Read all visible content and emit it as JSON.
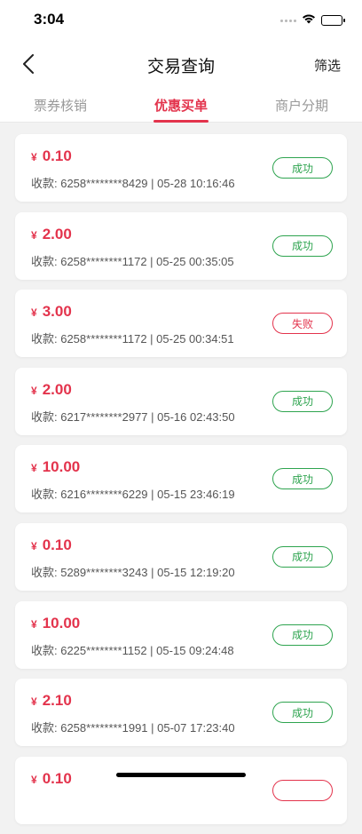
{
  "status_bar": {
    "time": "3:04"
  },
  "nav": {
    "title": "交易查询",
    "filter_label": "筛选"
  },
  "tabs": [
    {
      "label": "票券核销",
      "active": false
    },
    {
      "label": "优惠买单",
      "active": true
    },
    {
      "label": "商户分期",
      "active": false
    }
  ],
  "currency_symbol": "¥",
  "transactions": [
    {
      "amount": "0.10",
      "info": "收款: 6258********8429 | 05-28 10:16:46",
      "status": "成功",
      "status_type": "success"
    },
    {
      "amount": "2.00",
      "info": "收款: 6258********1172 | 05-25 00:35:05",
      "status": "成功",
      "status_type": "success"
    },
    {
      "amount": "3.00",
      "info": "收款: 6258********1172 | 05-25 00:34:51",
      "status": "失败",
      "status_type": "fail"
    },
    {
      "amount": "2.00",
      "info": "收款: 6217********2977 | 05-16 02:43:50",
      "status": "成功",
      "status_type": "success"
    },
    {
      "amount": "10.00",
      "info": "收款: 6216********6229 | 05-15 23:46:19",
      "status": "成功",
      "status_type": "success"
    },
    {
      "amount": "0.10",
      "info": "收款: 5289********3243 | 05-15 12:19:20",
      "status": "成功",
      "status_type": "success"
    },
    {
      "amount": "10.00",
      "info": "收款: 6225********1152 | 05-15 09:24:48",
      "status": "成功",
      "status_type": "success"
    },
    {
      "amount": "2.10",
      "info": "收款: 6258********1991 | 05-07 17:23:40",
      "status": "成功",
      "status_type": "success"
    },
    {
      "amount": "0.10",
      "info": "",
      "status": "",
      "status_type": "fail"
    }
  ],
  "colors": {
    "accent": "#e3334c",
    "success": "#2ea44f"
  }
}
